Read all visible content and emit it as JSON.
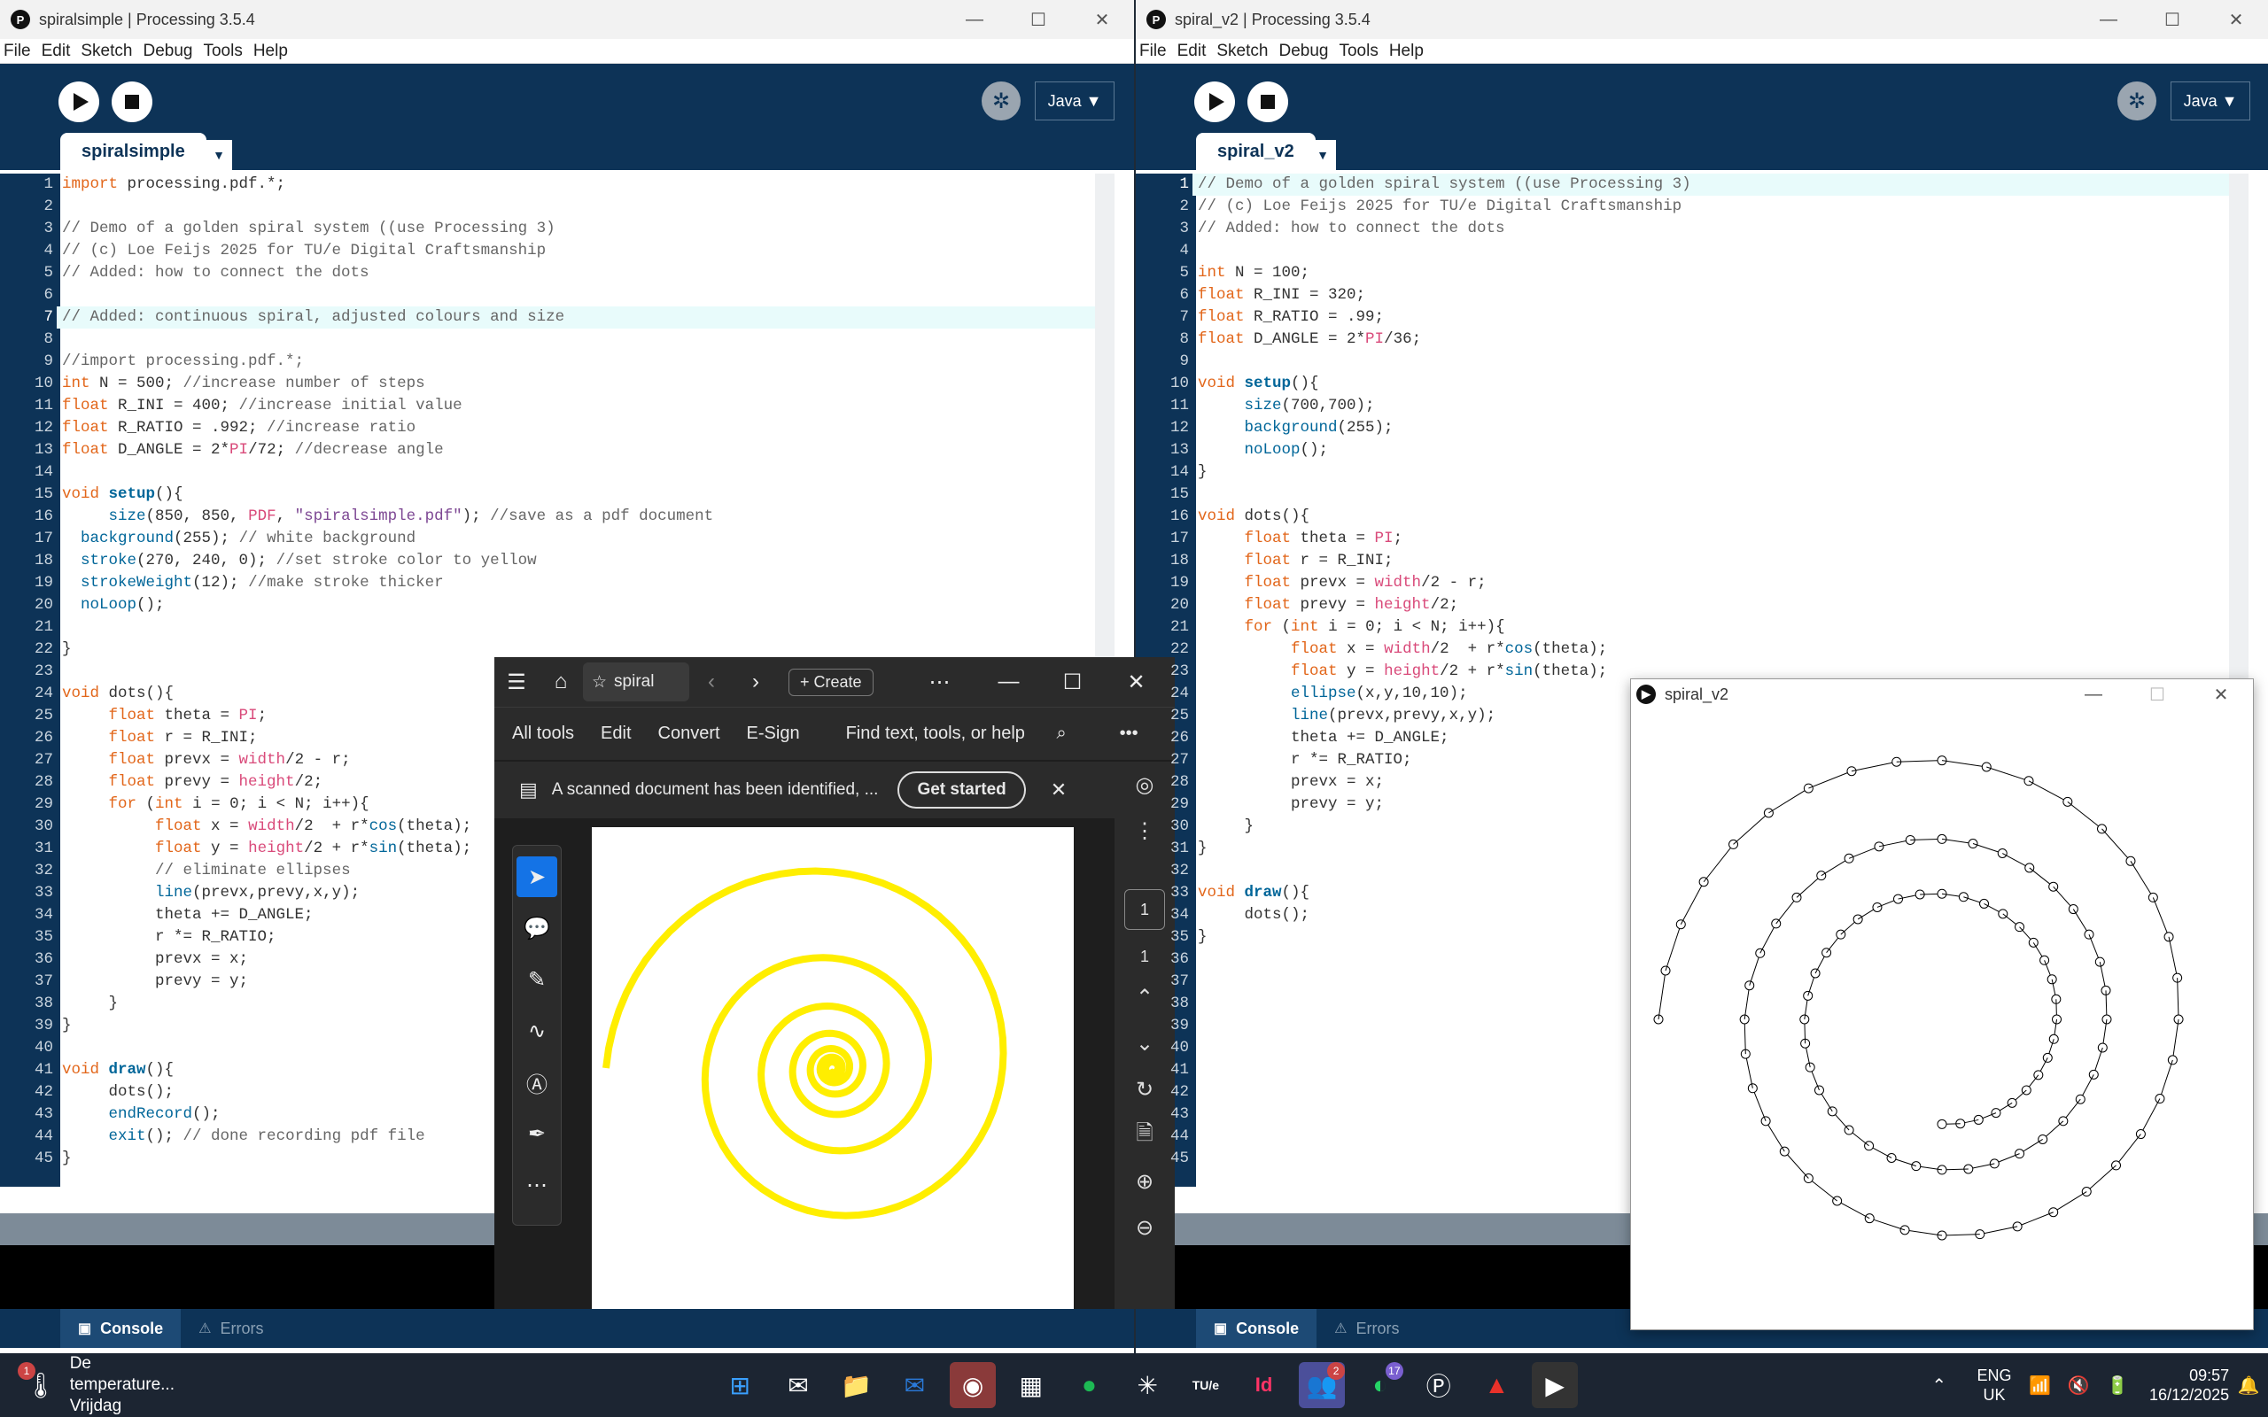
{
  "left": {
    "title": "spiralsimple | Processing 3.5.4",
    "tab": "spiralsimple",
    "mode": "Java ▼",
    "lines": [
      "import processing.pdf.*;",
      "",
      "// Demo of a golden spiral system ((use Processing 3)",
      "// (c) Loe Feijs 2025 for TU/e Digital Craftsmanship",
      "// Added: how to connect the dots",
      "",
      "// Added: continuous spiral, adjusted colours and size",
      "",
      "//import processing.pdf.*;",
      "int N = 500; //increase number of steps",
      "float R_INI = 400; //increase initial value",
      "float R_RATIO = .992; //increase ratio",
      "float D_ANGLE = 2*PI/72; //decrease angle",
      "",
      "void setup(){",
      "     size(850, 850, PDF, \"spiralsimple.pdf\"); //save as a pdf document",
      "  background(255); // white background",
      "  stroke(270, 240, 0); //set stroke color to yellow",
      "  strokeWeight(12); //make stroke thicker",
      "  noLoop();",
      "",
      "}",
      "",
      "void dots(){",
      "     float theta = PI;",
      "     float r = R_INI;",
      "     float prevx = width/2 - r;",
      "     float prevy = height/2;",
      "     for (int i = 0; i < N; i++){",
      "          float x = width/2  + r*cos(theta);",
      "          float y = height/2 + r*sin(theta);",
      "          // eliminate ellipses",
      "          line(prevx,prevy,x,y);",
      "          theta += D_ANGLE;",
      "          r *= R_RATIO;",
      "          prevx = x;",
      "          prevy = y;",
      "     }",
      "}",
      "",
      "void draw(){",
      "     dots();",
      "     endRecord();",
      "     exit(); // done recording pdf file",
      "}"
    ],
    "highlight_line": 7
  },
  "right": {
    "title": "spiral_v2 | Processing 3.5.4",
    "tab": "spiral_v2",
    "mode": "Java ▼",
    "lines": [
      "// Demo of a golden spiral system ((use Processing 3)",
      "// (c) Loe Feijs 2025 for TU/e Digital Craftsmanship",
      "// Added: how to connect the dots",
      "",
      "int N = 100;",
      "float R_INI = 320;",
      "float R_RATIO = .99;",
      "float D_ANGLE = 2*PI/36;",
      "",
      "void setup(){",
      "     size(700,700);",
      "     background(255);",
      "     noLoop();",
      "}",
      "",
      "void dots(){",
      "     float theta = PI;",
      "     float r = R_INI;",
      "     float prevx = width/2 - r;",
      "     float prevy = height/2;",
      "     for (int i = 0; i < N; i++){",
      "          float x = width/2  + r*cos(theta);",
      "          float y = height/2 + r*sin(theta);",
      "          ellipse(x,y,10,10);",
      "          line(prevx,prevy,x,y);",
      "          theta += D_ANGLE;",
      "          r *= R_RATIO;",
      "          prevx = x;",
      "          prevy = y;",
      "     }",
      "}",
      "",
      "void draw(){",
      "     dots();",
      "}",
      "",
      "",
      "",
      "",
      "",
      "",
      "",
      "",
      "",
      ""
    ],
    "highlight_line": 1
  },
  "menu": [
    "File",
    "Edit",
    "Sketch",
    "Debug",
    "Tools",
    "Help"
  ],
  "footer": {
    "console": "Console",
    "errors": "Errors"
  },
  "acrobat": {
    "tab_label": "spiral",
    "create": "Create",
    "menu": [
      "All tools",
      "Edit",
      "Convert",
      "E-Sign"
    ],
    "search": "Find text, tools, or help",
    "notice": "A scanned document has been identified, ...",
    "get_started": "Get started",
    "page_current": "1",
    "page_total": "1",
    "spiral_color": "#ffee00"
  },
  "sketch_window": {
    "title": "spiral_v2"
  },
  "taskbar": {
    "weather_title": "De temperature...",
    "weather_sub": "Vrijdag",
    "weather_badge": "1",
    "lang_top": "ENG",
    "lang_bottom": "UK",
    "time": "09:57",
    "date": "16/12/2025",
    "teams_badge": "2",
    "whatsapp_badge": "17",
    "tue": "TU/e"
  }
}
